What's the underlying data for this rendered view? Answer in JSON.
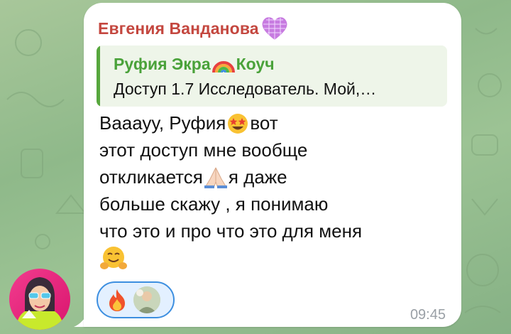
{
  "message": {
    "sender_name": "Евгения Ванданова",
    "sender_badge_icon": "disco-heart-icon",
    "reply": {
      "author_first": "Руфия Экра",
      "author_icon": "rainbow-icon",
      "author_last": "Коуч",
      "text": "Доступ 1.7 Исследователь.  Мой,…"
    },
    "lines": [
      {
        "text": "Вааауу, Руфия ",
        "emoji": "star-struck-emoji",
        "after": " вот"
      },
      {
        "text": "этот доступ мне вообще"
      },
      {
        "text": "откликается ",
        "emoji": "folded-hands-emoji",
        "after": " я даже"
      },
      {
        "text": "больше скажу , я понимаю"
      },
      {
        "text": "что это и про что это для меня"
      }
    ],
    "trailing_emoji": "hugging-face-emoji",
    "reactions": [
      {
        "icon": "fire-emoji"
      },
      {
        "icon": "reactor-avatar"
      }
    ],
    "time": "09:45"
  },
  "colors": {
    "sender": "#c4473f",
    "reply_author": "#4aa23a",
    "reply_bar": "#57a73d",
    "reaction_border": "#3d8fe0",
    "bubble": "#ffffff",
    "wallpaper": "#9cc394"
  }
}
